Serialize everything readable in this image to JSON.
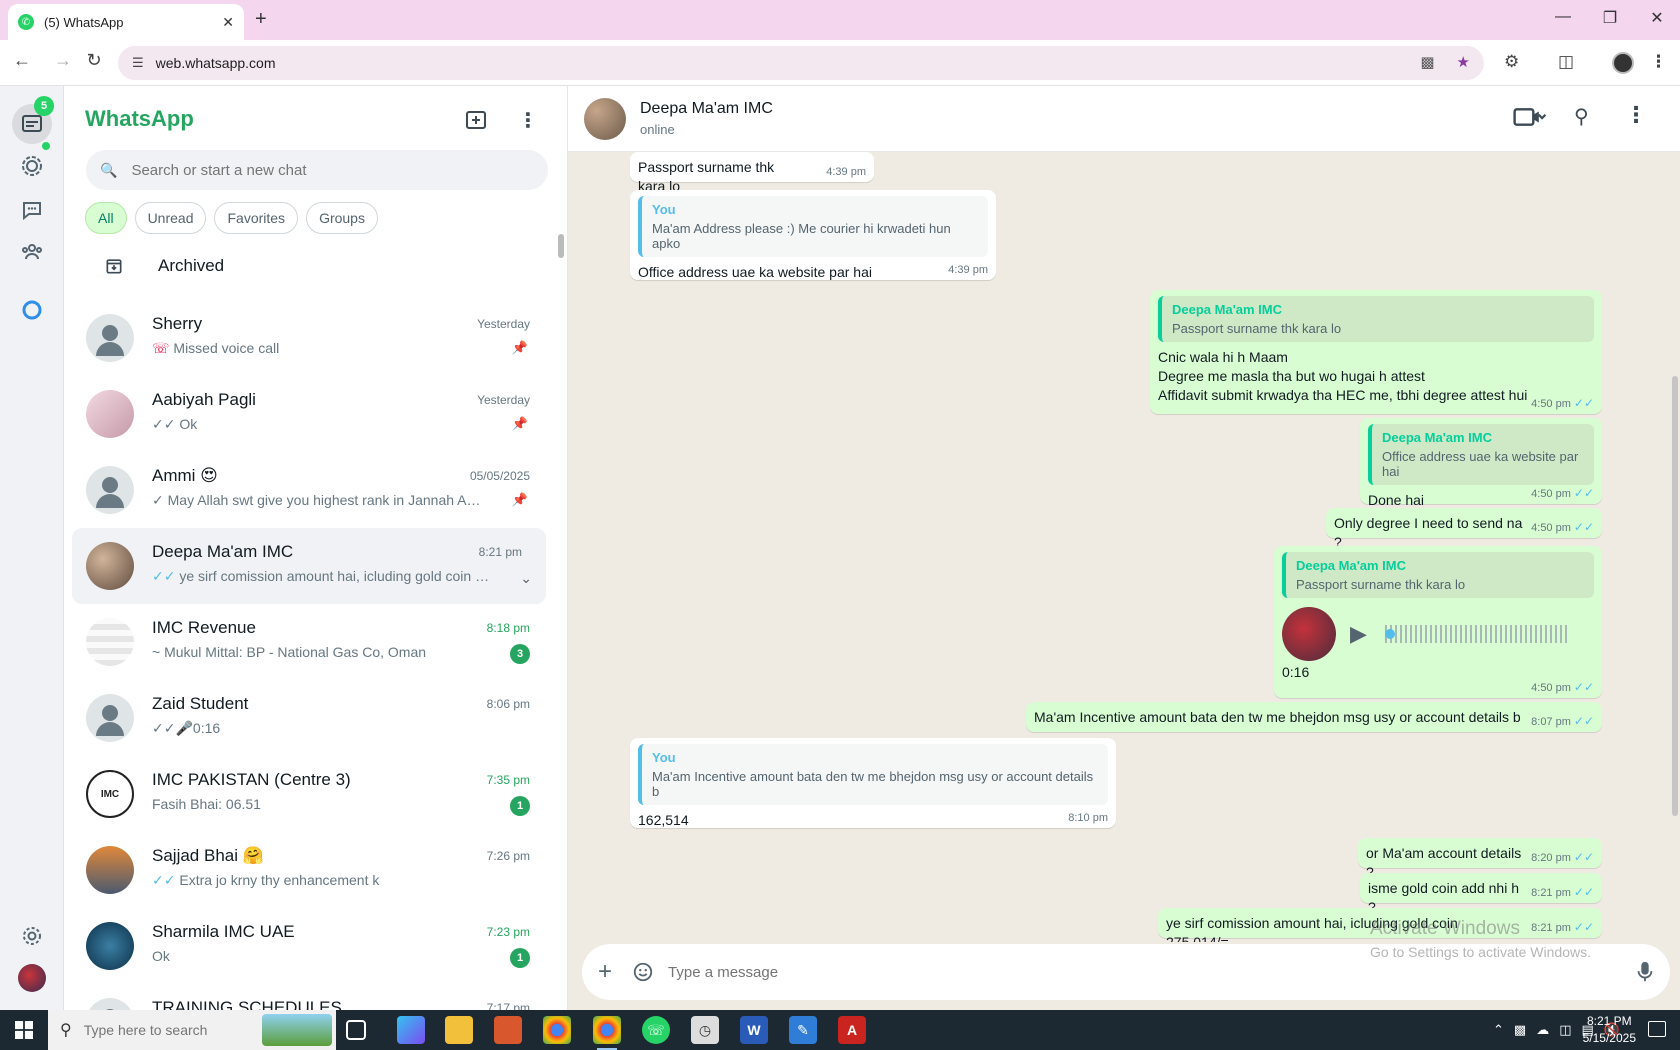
{
  "browser": {
    "tab_title": "(5) WhatsApp",
    "url": "web.whatsapp.com",
    "new_tab": "+",
    "tab_close": "✕"
  },
  "rail": {
    "chats_badge": "5"
  },
  "sidebar": {
    "brand": "WhatsApp",
    "search_placeholder": "Search or start a new chat",
    "filters": [
      "All",
      "Unread",
      "Favorites",
      "Groups"
    ],
    "archived_label": "Archived",
    "chats": [
      {
        "name": "Sherry",
        "preview": "Missed voice call",
        "time": "Yesterday",
        "pinned": true,
        "status": "missed"
      },
      {
        "name": "Aabiyah Pagli",
        "preview": "Ok",
        "time": "Yesterday",
        "pinned": true,
        "status": "read-grey"
      },
      {
        "name": "Ammi 😍",
        "preview": "May Allah swt give you highest rank in Jannah  Ameen",
        "time": "05/05/2025",
        "pinned": true,
        "status": "sent"
      },
      {
        "name": "Deepa Ma'am IMC",
        "preview": "ye sirf comission amount hai, icluding gold coin 275,014/=",
        "time": "8:21 pm",
        "selected": true,
        "status": "read-blue"
      },
      {
        "name": "IMC Revenue",
        "preview": "~ Mukul Mittal: BP - National Gas Co, Oman",
        "time": "8:18 pm",
        "unread": "3"
      },
      {
        "name": "Zaid Student",
        "preview": "0:16",
        "time": "8:06 pm",
        "status": "voice"
      },
      {
        "name": "IMC PAKISTAN (Centre 3)",
        "preview": "Fasih Bhai: 06.51",
        "time": "7:35 pm",
        "unread": "1"
      },
      {
        "name": "Sajjad Bhai 🤗",
        "preview": "Extra jo krny thy enhancement k",
        "time": "7:26 pm",
        "status": "read-blue"
      },
      {
        "name": "Sharmila IMC UAE",
        "preview": "Ok",
        "time": "7:23 pm",
        "unread": "1"
      },
      {
        "name": "TRAINING SCHEDULES",
        "preview": "",
        "time": "7:17 pm"
      }
    ]
  },
  "conversation": {
    "contact_name": "Deepa Ma'am IMC",
    "contact_status": "online",
    "messages": {
      "m1": {
        "text": "Passport surname thk kara lo",
        "time": "4:39 pm"
      },
      "m2": {
        "quote_author": "You",
        "quote_text": "Ma'am Address please :) Me courier hi krwadeti hun apko",
        "text": "Office address uae ka website par hai",
        "time": "4:39 pm"
      },
      "m3": {
        "quote_author": "Deepa Ma'am IMC",
        "quote_text": "Passport surname thk kara lo",
        "line1": "Cnic wala hi h Maam",
        "line2": "Degree me masla tha but wo hugai h attest",
        "line3": "Affidavit submit krwadya tha HEC me, tbhi degree attest hui",
        "time": "4:50 pm"
      },
      "m4": {
        "quote_author": "Deepa Ma'am IMC",
        "quote_text": "Office address uae ka website par hai",
        "text": "Done hai",
        "time": "4:50 pm"
      },
      "m5": {
        "text": "Only degree I need to send na ?",
        "time": "4:50 pm"
      },
      "m6": {
        "quote_author": "Deepa Ma'am IMC",
        "quote_text": "Passport surname thk kara lo",
        "duration": "0:16",
        "time": "4:50 pm"
      },
      "m7": {
        "text": "Ma'am Incentive amount bata den tw me bhejdon msg usy or account details b",
        "time": "8:07 pm"
      },
      "m8": {
        "quote_author": "You",
        "quote_text": "Ma'am Incentive amount bata den tw me bhejdon msg usy or account details b",
        "text": "162,514",
        "time": "8:10 pm"
      },
      "m9": {
        "text": "or Ma'am account details ?",
        "time": "8:20 pm"
      },
      "m10": {
        "text": "isme gold coin add nhi h ?",
        "time": "8:21 pm"
      },
      "m11": {
        "text": "ye sirf comission amount hai, icluding gold coin 275,014/=",
        "time": "8:21 pm"
      }
    },
    "composer_placeholder": "Type a message"
  },
  "watermark": {
    "line1": "Activate Windows",
    "line2": "Go to Settings to activate Windows."
  },
  "taskbar": {
    "search_placeholder": "Type here to search",
    "time": "8:21 PM",
    "date": "5/15/2025"
  },
  "colors": {
    "brand_green": "#25a55f",
    "outgoing_bubble": "#d9fdd3",
    "read_tick": "#53bdeb",
    "tab_strip": "#f5d6ef"
  }
}
